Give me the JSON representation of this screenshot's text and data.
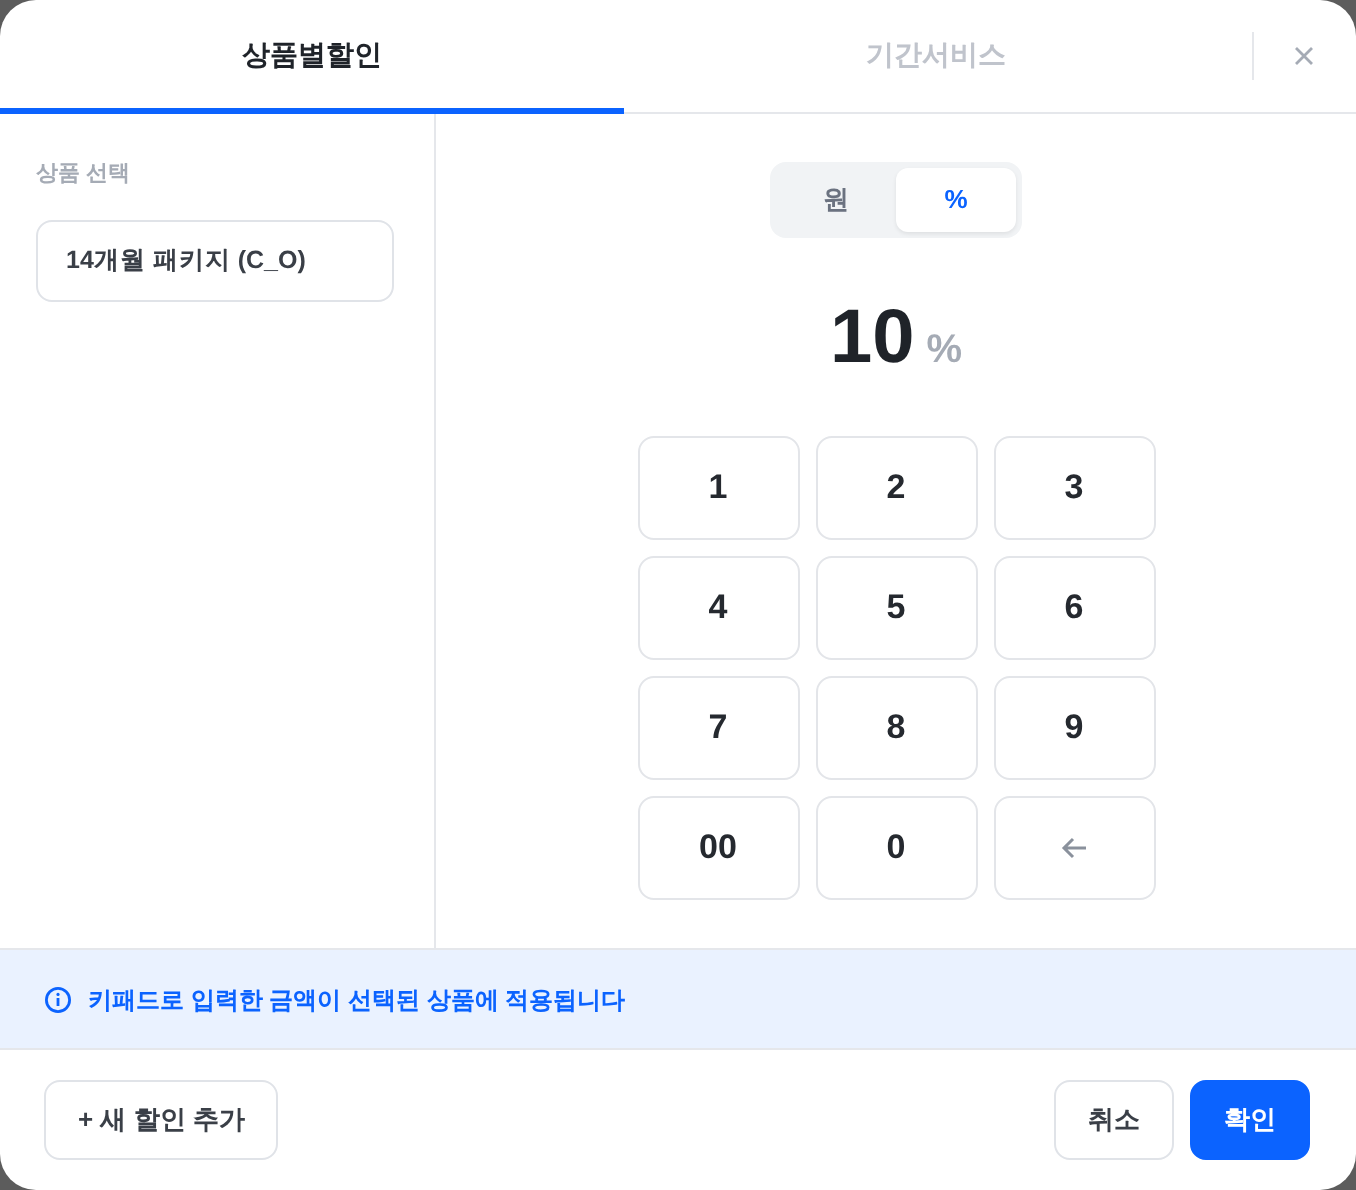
{
  "tabs": [
    {
      "label": "상품별할인",
      "selected": true
    },
    {
      "label": "기간서비스",
      "selected": false
    }
  ],
  "product_select": {
    "label": "상품 선택",
    "value": "14개월 패키지 (C_O)"
  },
  "unit_toggle": [
    {
      "label": "원",
      "selected": false
    },
    {
      "label": "%",
      "selected": true
    }
  ],
  "amount": {
    "value": "10",
    "unit": "%"
  },
  "keypad": [
    {
      "kind": "digit",
      "label": "1"
    },
    {
      "kind": "digit",
      "label": "2"
    },
    {
      "kind": "digit",
      "label": "3"
    },
    {
      "kind": "digit",
      "label": "4"
    },
    {
      "kind": "digit",
      "label": "5"
    },
    {
      "kind": "digit",
      "label": "6"
    },
    {
      "kind": "digit",
      "label": "7"
    },
    {
      "kind": "digit",
      "label": "8"
    },
    {
      "kind": "digit",
      "label": "9"
    },
    {
      "kind": "digit",
      "label": "00"
    },
    {
      "kind": "digit",
      "label": "0"
    },
    {
      "kind": "backspace"
    }
  ],
  "info": "키패드로 입력한 금액이 선택된 상품에 적용됩니다",
  "footer": {
    "add_button": "+ 새 할인 추가",
    "cancel_button": "취소",
    "confirm_button": "확인"
  }
}
